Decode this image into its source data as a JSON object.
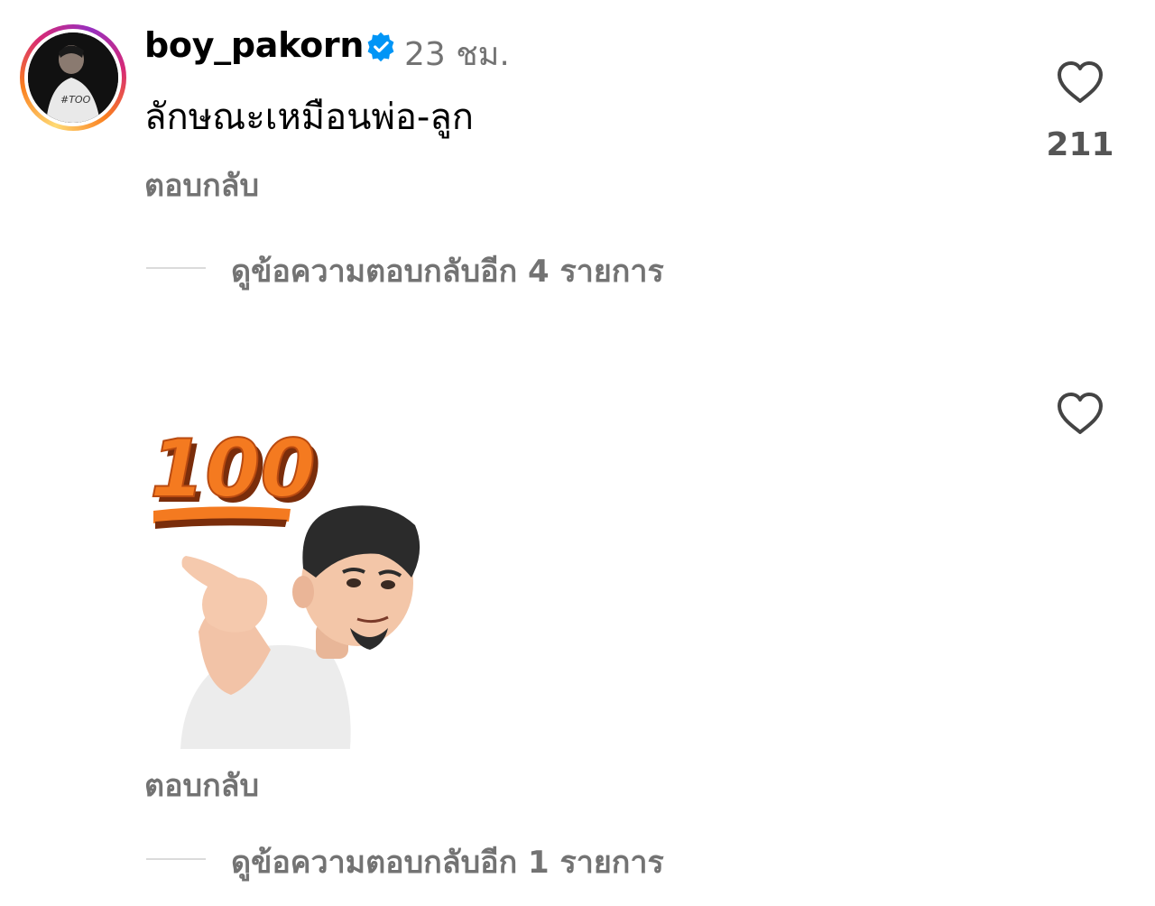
{
  "comment": {
    "username": "boy_pakorn",
    "verified": true,
    "time": "23 ชม.",
    "text": "ลักษณะเหมือนพ่อ-ลูก",
    "reply_label": "ตอบกลับ",
    "view_replies": "ดูข้อความตอบกลับอีก 4 รายการ",
    "like_count": "211",
    "avatar_shirt_text": "#TOO"
  },
  "sticker_comment": {
    "sticker_text": "100",
    "reply_label": "ตอบกลับ",
    "view_replies": "ดูข้อความตอบกลับอีก 1 รายการ"
  },
  "colors": {
    "verified_blue": "#0095f6",
    "secondary_text": "#737373",
    "sticker_orange": "#f47a20",
    "sticker_shadow": "#7a2d0b"
  },
  "icons": {
    "verified": "verified-badge-icon",
    "like": "heart-outline-icon"
  }
}
